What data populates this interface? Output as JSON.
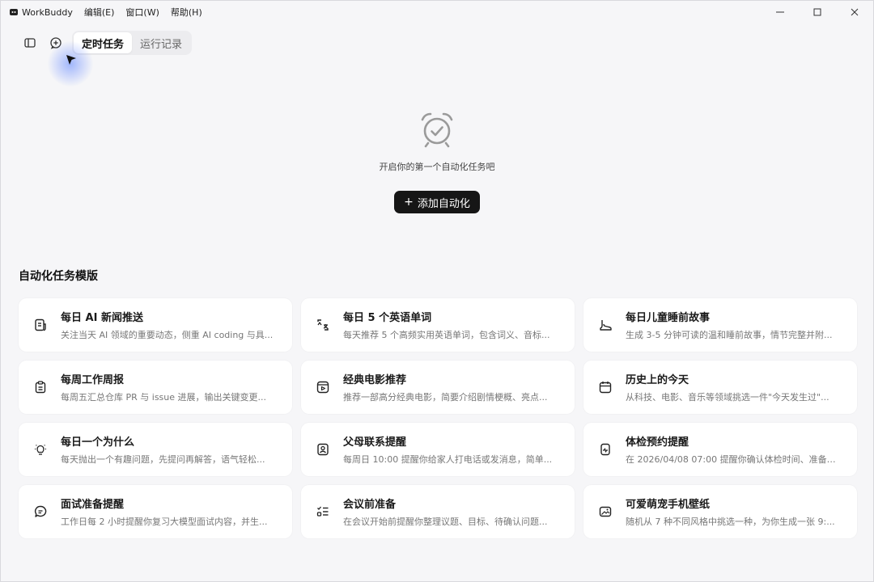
{
  "titlebar": {
    "app_name": "WorkBuddy",
    "menus": [
      "编辑(E)",
      "窗口(W)",
      "帮助(H)"
    ]
  },
  "toolbar": {
    "tabs": [
      {
        "label": "定时任务",
        "active": true
      },
      {
        "label": "运行记录",
        "active": false
      }
    ]
  },
  "empty_state": {
    "message": "开启你的第一个自动化任务吧",
    "add_button_label": "添加自动化",
    "add_button_icon": "+"
  },
  "templates": {
    "title": "自动化任务模版",
    "items": [
      {
        "icon": "news-icon",
        "title": "每日 AI 新闻推送",
        "desc": "关注当天 AI 领域的重要动态，侧重 AI coding 与具..."
      },
      {
        "icon": "translate-icon",
        "title": "每日 5 个英语单词",
        "desc": "每天推荐 5 个高频实用英语单词，包含词义、音标..."
      },
      {
        "icon": "boot-icon",
        "title": "每日儿童睡前故事",
        "desc": "生成 3-5 分钟可读的温和睡前故事，情节完整并附..."
      },
      {
        "icon": "clipboard-icon",
        "title": "每周工作周报",
        "desc": "每周五汇总仓库 PR 与 issue 进展，输出关键变更..."
      },
      {
        "icon": "film-icon",
        "title": "经典电影推荐",
        "desc": "推荐一部高分经典电影，简要介绍剧情梗概、亮点..."
      },
      {
        "icon": "calendar-icon",
        "title": "历史上的今天",
        "desc": "从科技、电影、音乐等领域挑选一件\"今天发生过\"..."
      },
      {
        "icon": "lightbulb-icon",
        "title": "每日一个为什么",
        "desc": "每天抛出一个有趣问题，先提问再解答，语气轻松..."
      },
      {
        "icon": "contact-icon",
        "title": "父母联系提醒",
        "desc": "每周日 10:00 提醒你给家人打电话或发消息，简单..."
      },
      {
        "icon": "health-icon",
        "title": "体检预约提醒",
        "desc": "在 2026/04/08 07:00 提醒你确认体检时间、准备证..."
      },
      {
        "icon": "chat-icon",
        "title": "面试准备提醒",
        "desc": "工作日每 2 小时提醒你复习大模型面试内容，并生..."
      },
      {
        "icon": "checklist-icon",
        "title": "会议前准备",
        "desc": "在会议开始前提醒你整理议题、目标、待确认问题..."
      },
      {
        "icon": "image-icon",
        "title": "可爱萌宠手机壁纸",
        "desc": "随机从 7 种不同风格中挑选一种，为你生成一张 9:..."
      }
    ]
  },
  "colors": {
    "background": "#f6f6f8",
    "card": "#ffffff",
    "primary_button": "#161616",
    "cursor_glow": "#5a82ff"
  }
}
